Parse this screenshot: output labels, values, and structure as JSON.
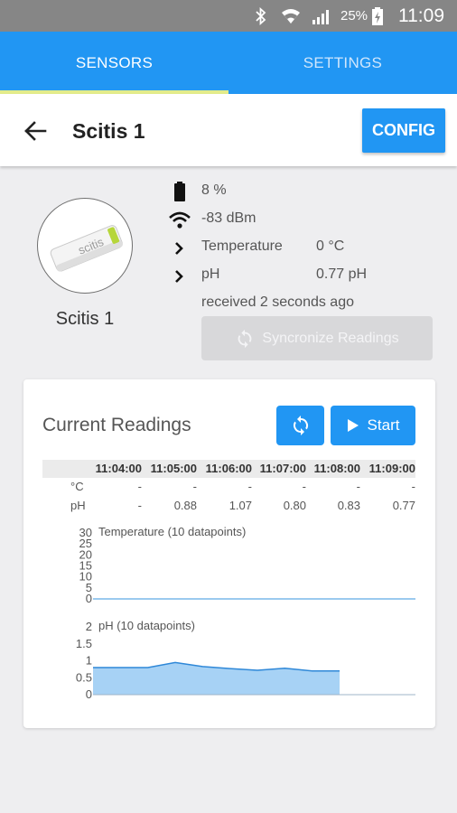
{
  "status_bar": {
    "battery_percent": "25%",
    "time": "11:09",
    "icons": [
      "bluetooth-icon",
      "wifi-icon",
      "signal-icon",
      "battery-charging-icon"
    ]
  },
  "tabs": [
    {
      "label": "SENSORS",
      "active": true
    },
    {
      "label": "SETTINGS",
      "active": false
    }
  ],
  "app_bar": {
    "title": "Scitis 1",
    "config_label": "CONFIG"
  },
  "device": {
    "name": "Scitis 1",
    "image_text": "scitis",
    "battery": "8 %",
    "signal": "-83 dBm",
    "sensors": [
      {
        "label": "Temperature",
        "value": "0 °C"
      },
      {
        "label": "pH",
        "value": "0.77 pH"
      }
    ],
    "received": "received 2 seconds ago",
    "sync_label": "Syncronize Readings"
  },
  "readings": {
    "title": "Current Readings",
    "start_label": "Start",
    "columns": [
      "11:04:00",
      "11:05:00",
      "11:06:00",
      "11:07:00",
      "11:08:00",
      "11:09:00"
    ],
    "rows": [
      {
        "label": "°C",
        "values": [
          "-",
          "-",
          "-",
          "-",
          "-",
          "-"
        ]
      },
      {
        "label": "pH",
        "values": [
          "-",
          "0.88",
          "1.07",
          "0.80",
          "0.83",
          "0.77"
        ]
      }
    ]
  },
  "chart_data": [
    {
      "type": "line",
      "title": "Temperature (10 datapoints)",
      "yticks": [
        "30",
        "25",
        "20",
        "15",
        "10",
        "5",
        "0"
      ],
      "ylim": [
        0,
        30
      ],
      "values": [
        0,
        0,
        0,
        0,
        0,
        0,
        0,
        0,
        0,
        0
      ],
      "color": "#7ab8ea"
    },
    {
      "type": "area",
      "title": "pH (10 datapoints)",
      "yticks": [
        "2",
        "1.5",
        "1",
        "0.5",
        "0"
      ],
      "ylim": [
        0,
        2
      ],
      "values": [
        0.8,
        0.8,
        0.8,
        0.95,
        0.83,
        0.77,
        0.72,
        0.78,
        0.7,
        0.7
      ],
      "fill": "#a7d2f5",
      "stroke": "#2f88d8"
    }
  ],
  "colors": {
    "primary": "#2196f3",
    "tab_indicator": "#e3ec8a",
    "status_bar": "#868686"
  }
}
